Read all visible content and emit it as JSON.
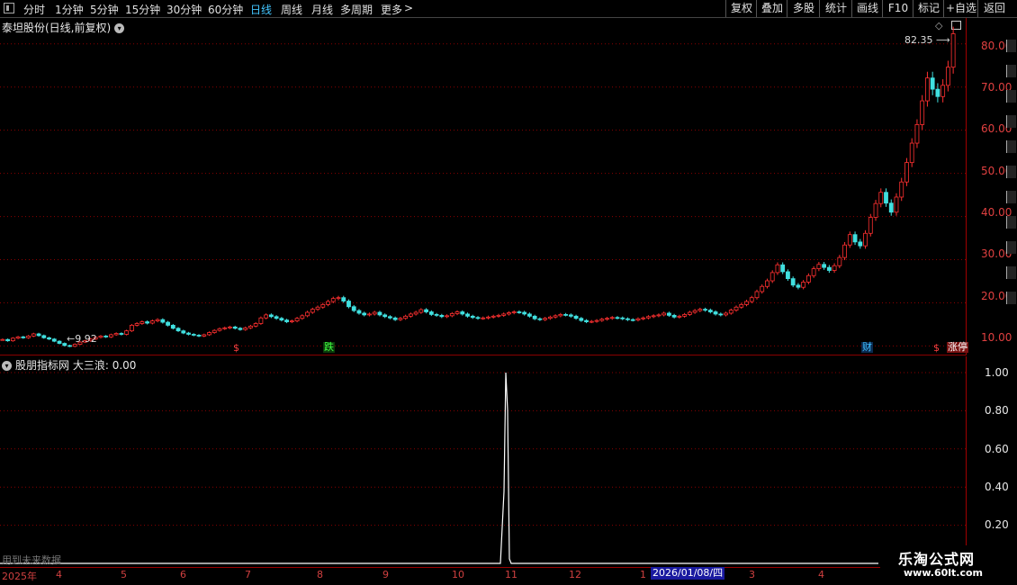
{
  "toolbar": {
    "periods": [
      "分时",
      "1分钟",
      "5分钟",
      "15分钟",
      "30分钟",
      "60分钟",
      "日线",
      "周线",
      "月线",
      "多周期",
      "更多"
    ],
    "active_period": "日线",
    "more_arrow": ">",
    "right_buttons": [
      "复权",
      "叠加",
      "多股",
      "统计",
      "画线",
      "F10",
      "标记",
      "+自选",
      "返回"
    ]
  },
  "main_chart": {
    "title": "泰坦股份(日线,前复权)",
    "title_icon": "chevron-down-icon",
    "max_label": "82.35",
    "min_label": "9.92",
    "price_ticks": [
      "80.00",
      "70.00",
      "60.00",
      "50.00",
      "40.00",
      "30.00",
      "20.00",
      "10.00"
    ],
    "markers": [
      {
        "text": "$",
        "color": "#ff4040"
      },
      {
        "text": "跌",
        "color": "#40ff40"
      },
      {
        "text": "财",
        "color": "#40c0ff"
      },
      {
        "text": "$",
        "color": "#ff4040"
      },
      {
        "text": "涨停",
        "color": "#ffffff"
      }
    ],
    "colors": {
      "up": "#ff3030",
      "down": "#40e0e0",
      "grid": "#8a0000",
      "axis": "#e04040"
    }
  },
  "sub_chart": {
    "indicator_source": "股朋指标网",
    "indicator_name": "大三浪",
    "indicator_value": "0.00",
    "ticks": [
      "1.00",
      "0.80",
      "0.60",
      "0.40",
      "0.20"
    ],
    "future_note": "用到未来数据"
  },
  "date_axis": {
    "labels": [
      "2025年",
      "4",
      "5",
      "6",
      "7",
      "8",
      "9",
      "10",
      "11",
      "12",
      "1",
      "3",
      "4"
    ],
    "cursor_date": "2026/01/08/四"
  },
  "watermark": {
    "title": "乐淘公式网",
    "url": "www.60lt.com"
  },
  "chart_data": {
    "type": "candlestick",
    "title": "泰坦股份(日线,前复权)",
    "ylim": [
      8,
      86
    ],
    "series": [
      {
        "values": [
          11.5,
          11.2,
          11.8,
          12.1,
          11.9,
          12.3,
          12.8,
          12.4,
          11.9,
          11.6,
          11.1,
          10.6,
          10.1,
          9.92,
          10.4,
          10.9,
          11.2,
          11.6,
          12.0,
          12.3,
          12.1,
          12.6,
          12.9,
          12.7,
          13.5,
          14.8,
          15.2,
          15.6,
          15.3,
          15.8,
          16.1,
          15.5,
          14.8,
          14.1,
          13.5,
          13.0,
          12.7,
          12.5,
          12.3,
          12.6,
          13.1,
          13.6,
          14.0,
          14.2,
          14.4,
          14.1,
          13.8,
          14.2,
          14.6,
          15.2,
          16.5,
          17.2,
          16.8,
          16.4,
          16.0,
          15.6,
          15.8,
          16.4,
          17.0,
          17.8,
          18.5,
          19.0,
          19.6,
          20.3,
          21.0,
          21.2,
          20.4,
          19.1,
          18.2,
          17.6,
          17.2,
          17.4,
          17.8,
          17.2,
          16.8,
          16.5,
          16.1,
          16.4,
          16.9,
          17.4,
          17.8,
          18.4,
          17.9,
          17.3,
          17.1,
          16.8,
          17.0,
          17.5,
          17.9,
          17.4,
          16.9,
          16.6,
          16.4,
          16.5,
          16.7,
          16.9,
          17.1,
          17.4,
          17.7,
          17.9,
          17.8,
          17.4,
          16.9,
          16.3,
          16.1,
          16.4,
          16.7,
          17.0,
          17.3,
          17.2,
          16.9,
          16.4,
          15.9,
          15.6,
          15.7,
          15.9,
          16.2,
          16.4,
          16.6,
          16.5,
          16.3,
          16.1,
          16.0,
          16.3,
          16.5,
          16.8,
          17.0,
          17.2,
          17.6,
          17.1,
          16.7,
          16.9,
          17.3,
          17.8,
          18.2,
          18.5,
          18.3,
          17.9,
          17.4,
          17.2,
          17.6,
          18.3,
          19.0,
          19.6,
          20.3,
          21.2,
          22.6,
          23.8,
          25.1,
          27.0,
          28.8,
          27.2,
          25.6,
          24.1,
          23.6,
          24.8,
          26.3,
          27.9,
          28.9,
          28.2,
          27.5,
          28.6,
          30.5,
          33.4,
          35.8,
          34.1,
          33.2,
          36.1,
          39.8,
          43.0,
          45.6,
          43.1,
          41.0,
          44.5,
          48.0,
          52.5,
          57.0,
          61.3,
          66.8,
          72.1,
          69.5,
          67.8,
          70.4,
          74.6,
          82.35
        ]
      }
    ]
  }
}
